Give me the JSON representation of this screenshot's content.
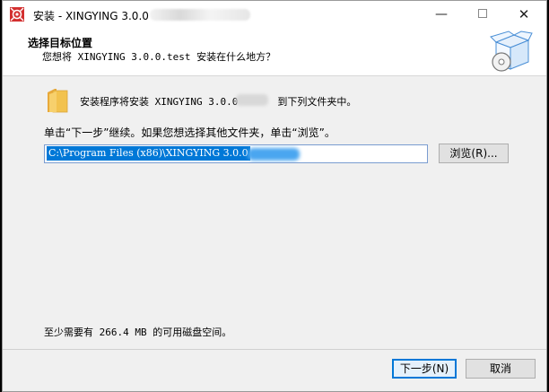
{
  "window": {
    "title": "安装 - XINGYING 3.0.0",
    "minimize_glyph": "—",
    "close_glyph": "✕"
  },
  "header": {
    "title": "选择目标位置",
    "subtitle": "您想将 XINGYING 3.0.0.test 安装在什么地方？"
  },
  "body": {
    "dest_prefix": "安装程序将安装 XINGYING 3.0.0",
    "dest_suffix": "到下列文件夹中。",
    "instruction": "单击“下一步”继续。如果您想选择其他文件夹，单击“浏览”。",
    "path_value": "C:\\Program Files (x86)\\XINGYING 3.0.0",
    "browse_label": "浏览(R)...",
    "space_required": "至少需要有 266.4 MB 的可用磁盘空间。"
  },
  "footer": {
    "next_label": "下一步(N)",
    "cancel_label": "取消"
  },
  "colors": {
    "accent": "#0078d7",
    "app_icon": "#d32f2f",
    "folder": "#f2c24e"
  }
}
